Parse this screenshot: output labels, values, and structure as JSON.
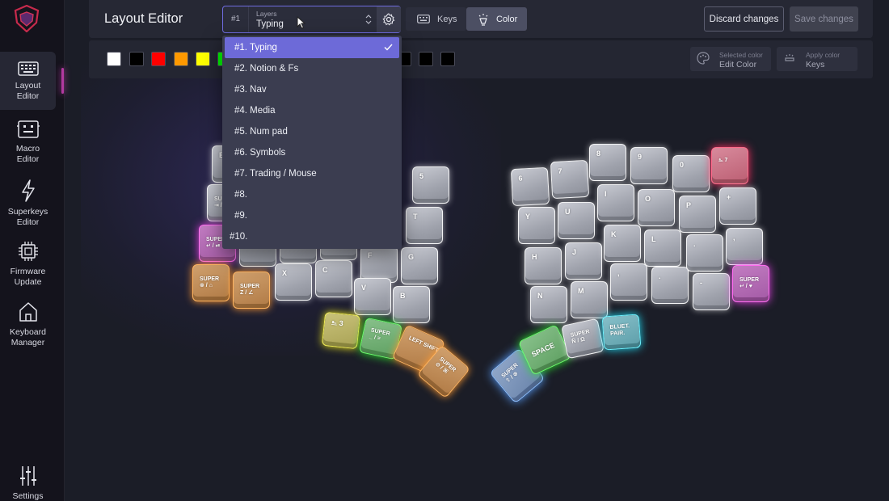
{
  "sidebar": {
    "items": [
      {
        "label": "Layout\nEditor",
        "l1": "Layout",
        "l2": "Editor",
        "icon": "keyboard-icon"
      },
      {
        "l1": "Macro",
        "l2": "Editor",
        "icon": "macro-icon"
      },
      {
        "l1": "Superkeys",
        "l2": "Editor",
        "icon": "lightning-icon"
      },
      {
        "l1": "Firmware",
        "l2": "Update",
        "icon": "chip-icon"
      },
      {
        "l1": "Keyboard",
        "l2": "Manager",
        "icon": "home-icon"
      },
      {
        "l1": "Settings",
        "icon": "sliders-icon"
      }
    ]
  },
  "header": {
    "title": "Layout Editor",
    "layer_number": "#1",
    "layer_caption": "Layers",
    "layer_value": "Typing",
    "mode_keys": "Keys",
    "mode_color": "Color",
    "discard": "Discard changes",
    "save": "Save changes"
  },
  "palette": {
    "colors": [
      "#ffffff",
      "#000000",
      "#ff0000",
      "#ff9900",
      "#ffff00",
      "#00ff00",
      "#000000",
      "#000000",
      "#000000"
    ],
    "selected_caption": "Selected color",
    "selected_value": "Edit Color",
    "apply_caption": "Apply color",
    "apply_value": "Keys"
  },
  "layers": [
    "#1. Typing",
    "#2. Notion & Fs",
    "#3. Nav",
    "#4. Media",
    "#5. Num pad",
    "#6. Symbols",
    "#7. Trading / Mouse",
    "#8.",
    "#9.",
    "#10."
  ],
  "selected_layer_index": 0,
  "keys": {
    "left": {
      "row_num": [
        "E",
        "5"
      ],
      "row_top": [
        "T"
      ],
      "row_home": [
        "F",
        "G"
      ],
      "row_bottom": [
        "X",
        "C",
        "V",
        "B"
      ],
      "super_tab": "SUPER",
      "super_tab_sub": "⇥ /",
      "super_enter": "SUPER",
      "super_enter_sub": "↵ / ⏯",
      "super_a": "SUPER",
      "super_a_sub": "⊗ / ⌂",
      "super_z": "SUPER",
      "super_z_sub": "Z / ∠",
      "thumb_layer3": "⎁ 3",
      "thumb_super": "SUPER",
      "thumb_super_sub": "_ / ≡",
      "thumb_shift": "LEFT SHIFT",
      "thumb_super2": "SUPER",
      "thumb_super2_sub": "⊘ / ⌘"
    },
    "right": {
      "row_num": [
        "6",
        "7",
        "8",
        "9",
        "0",
        "⎁ 7"
      ],
      "row_top": [
        "Y",
        "U",
        "I",
        "O",
        "P",
        "+"
      ],
      "row_home": [
        "H",
        "J",
        "K",
        "L",
        ".",
        ","
      ],
      "row_bottom": [
        "N",
        "M",
        ",",
        ".",
        "-"
      ],
      "super_ret": "SUPER",
      "super_ret_sub": "↵ / ♥",
      "thumb_super_up": "SUPER",
      "thumb_super_up_sub": "⇧ / ⊗",
      "thumb_space": "SPACE",
      "thumb_super_n": "SUPER",
      "thumb_super_n_sub": "Ñ / Ω",
      "thumb_bt": "BLUET.",
      "thumb_bt_sub": "PAIR."
    }
  }
}
